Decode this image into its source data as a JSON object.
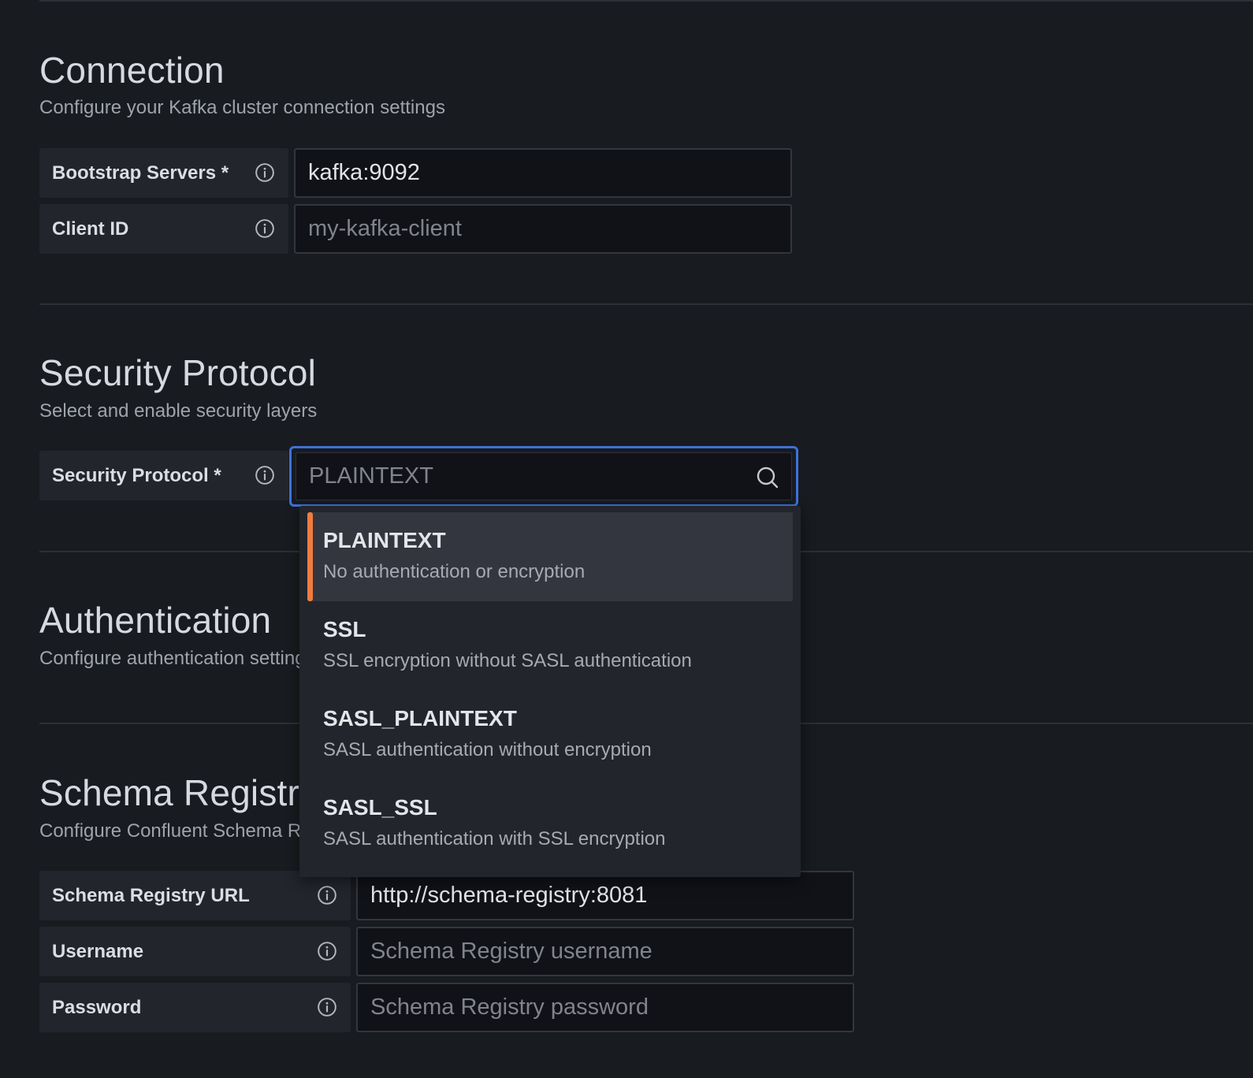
{
  "colors": {
    "background": "#181b1f",
    "focus_border": "#3d71d9",
    "active_accent": "#f07c3e"
  },
  "connection": {
    "title": "Connection",
    "description": "Configure your Kafka cluster connection settings",
    "fields": [
      {
        "label": "Bootstrap Servers *",
        "icon": "info-icon",
        "value": "kafka:9092",
        "placeholder": ""
      },
      {
        "label": "Client ID",
        "icon": "info-icon",
        "value": "",
        "placeholder": "my-kafka-client"
      }
    ]
  },
  "security": {
    "title": "Security Protocol",
    "description": "Select and enable security layers",
    "field": {
      "label": "Security Protocol *",
      "icon": "info-icon",
      "placeholder": "PLAINTEXT",
      "search_icon": "search-icon"
    },
    "options": [
      {
        "label": "PLAINTEXT",
        "description": "No authentication or encryption",
        "active": true
      },
      {
        "label": "SSL",
        "description": "SSL encryption without SASL authentication",
        "active": false
      },
      {
        "label": "SASL_PLAINTEXT",
        "description": "SASL authentication without encryption",
        "active": false
      },
      {
        "label": "SASL_SSL",
        "description": "SASL authentication with SSL encryption",
        "active": false
      }
    ]
  },
  "authentication": {
    "title": "Authentication",
    "description": "Configure authentication settings"
  },
  "schema_registry": {
    "title": "Schema Registry",
    "description": "Configure Confluent Schema Registry",
    "fields": [
      {
        "label": "Schema Registry URL",
        "icon": "info-icon",
        "value": "http://schema-registry:8081",
        "placeholder": ""
      },
      {
        "label": "Username",
        "icon": "info-icon",
        "value": "",
        "placeholder": "Schema Registry username"
      },
      {
        "label": "Password",
        "icon": "info-icon",
        "value": "",
        "placeholder": "Schema Registry password"
      }
    ]
  }
}
